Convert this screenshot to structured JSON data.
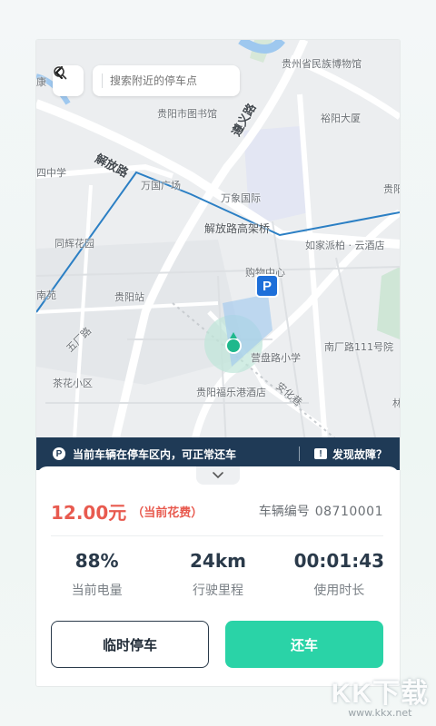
{
  "map": {
    "search_placeholder": "搜索附近的停车点",
    "labels": {
      "guizhou_museum": "贵州省民族博物馆",
      "library": "贵阳市图书馆",
      "yuyang": "裕阳大厦",
      "jiefang_road": "解放路",
      "wanguo_square": "万国广场",
      "wanxiang": "万象国际",
      "elevated_bridge": "解放路高架桥",
      "rujia": "如家派柏 · 云酒店",
      "tonghui": "同辉花园",
      "middle_school": "四中学",
      "guiyang_station": "贵阳站",
      "shopping_center": "购物中心",
      "wuchang_road": "五厂路",
      "yingpan_school": "营盘路小学",
      "nanchang_road_111": "南厂路111号院",
      "chahua": "茶花小区",
      "fulegang_hotel": "贵阳福乐港酒店",
      "zunyi_road": "遵义路",
      "nanyuan": "南苑",
      "guiyang_right": "贵阳",
      "kang": "康",
      "lin": "林",
      "anhua": "安化巷"
    },
    "parking_marker": "P"
  },
  "notice": {
    "text": "当前车辆在停车区内，可正常还车",
    "report": "发现故障？"
  },
  "panel": {
    "fee_amount": "12.00元",
    "fee_note": "（当前花费）",
    "vehicle_label": "车辆编号",
    "vehicle_id": "08710001",
    "stats": [
      {
        "value": "88%",
        "label": "当前电量"
      },
      {
        "value": "24km",
        "label": "行驶里程"
      },
      {
        "value": "00:01:43",
        "label": "使用时长"
      }
    ],
    "temp_park": "临时停车",
    "return_car": "还车"
  },
  "watermark": {
    "logo": "KK下载",
    "url": "www.kkx.net"
  },
  "colors": {
    "accent": "#2ad3a7",
    "fee": "#e85a4f",
    "notice_bg": "#1f3a56",
    "route": "#2b7fc4"
  }
}
